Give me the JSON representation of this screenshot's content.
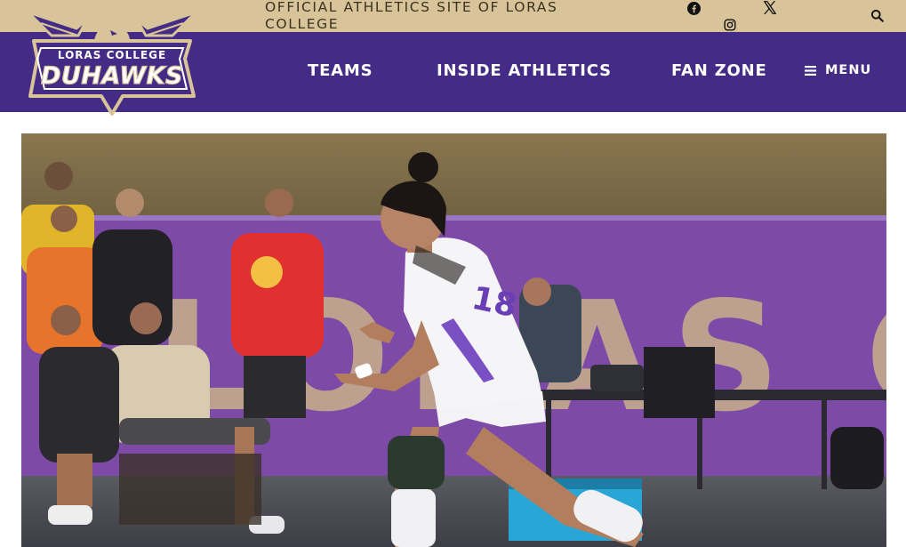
{
  "topbar": {
    "tagline": "OFFICIAL ATHLETICS SITE OF LORAS COLLEGE",
    "social": [
      "facebook-icon",
      "x-icon",
      "instagram-icon"
    ],
    "search_icon": "search-icon",
    "background": "#d9c49a"
  },
  "logo": {
    "line1": "LORAS COLLEGE",
    "line2": "DUHAWKS",
    "colors": {
      "purple": "#432b86",
      "gold": "#d9c49a"
    }
  },
  "nav": {
    "items": [
      {
        "label": "TEAMS"
      },
      {
        "label": "INSIDE ATHLETICS"
      },
      {
        "label": "FAN ZONE"
      }
    ],
    "menu_label": "MENU",
    "menu_icon": "hamburger-icon",
    "background": "#432b86"
  },
  "hero": {
    "banner_text": "LORAS COLLEGE",
    "jersey_number": "18"
  }
}
